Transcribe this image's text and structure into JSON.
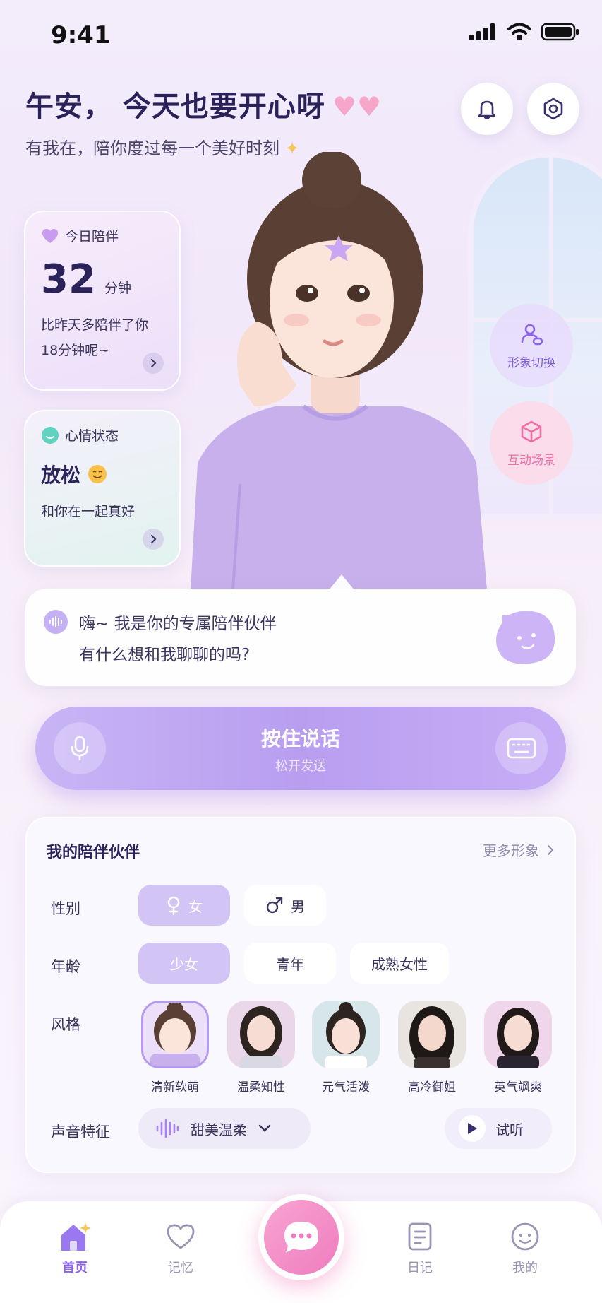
{
  "status": {
    "time": "9:41"
  },
  "header": {
    "greeting": "午安， 今天也要开心呀",
    "subtitle": "有我在，陪你度过每一个美好时刻"
  },
  "today_card": {
    "title": "今日陪伴",
    "value": "32",
    "unit": "分钟",
    "line1": "比昨天多陪伴了你",
    "line2": "18分钟呢~"
  },
  "mood_card": {
    "title": "心情状态",
    "mood": "放松",
    "desc": "和你在一起真好"
  },
  "side_actions": {
    "avatar_switch": "形象切换",
    "scene": "互动场景"
  },
  "bubble": {
    "line1": "嗨~ 我是你的专属陪伴伙伴",
    "line2": "有什么想和我聊聊的吗?"
  },
  "voice": {
    "main": "按住说话",
    "sub": "松开发送"
  },
  "companion": {
    "title": "我的陪伴伙伴",
    "more": "更多形象",
    "gender_label": "性别",
    "gender_female": "女",
    "gender_male": "男",
    "age_label": "年龄",
    "ages": [
      "少女",
      "青年",
      "成熟女性"
    ],
    "style_label": "风格",
    "styles": [
      "清新软萌",
      "温柔知性",
      "元气活泼",
      "高冷御姐",
      "英气飒爽"
    ],
    "voice_label": "声音特征",
    "voice_value": "甜美温柔",
    "listen": "试听"
  },
  "tabs": {
    "home": "首页",
    "memory": "记忆",
    "diary": "日记",
    "mine": "我的"
  },
  "colors": {
    "accent": "#8b63ee",
    "voice_bar": "#b99ef0",
    "chip_active": "#d3c4f6",
    "fab_pink": "#f07cbf",
    "title_dark": "#2a2258"
  }
}
